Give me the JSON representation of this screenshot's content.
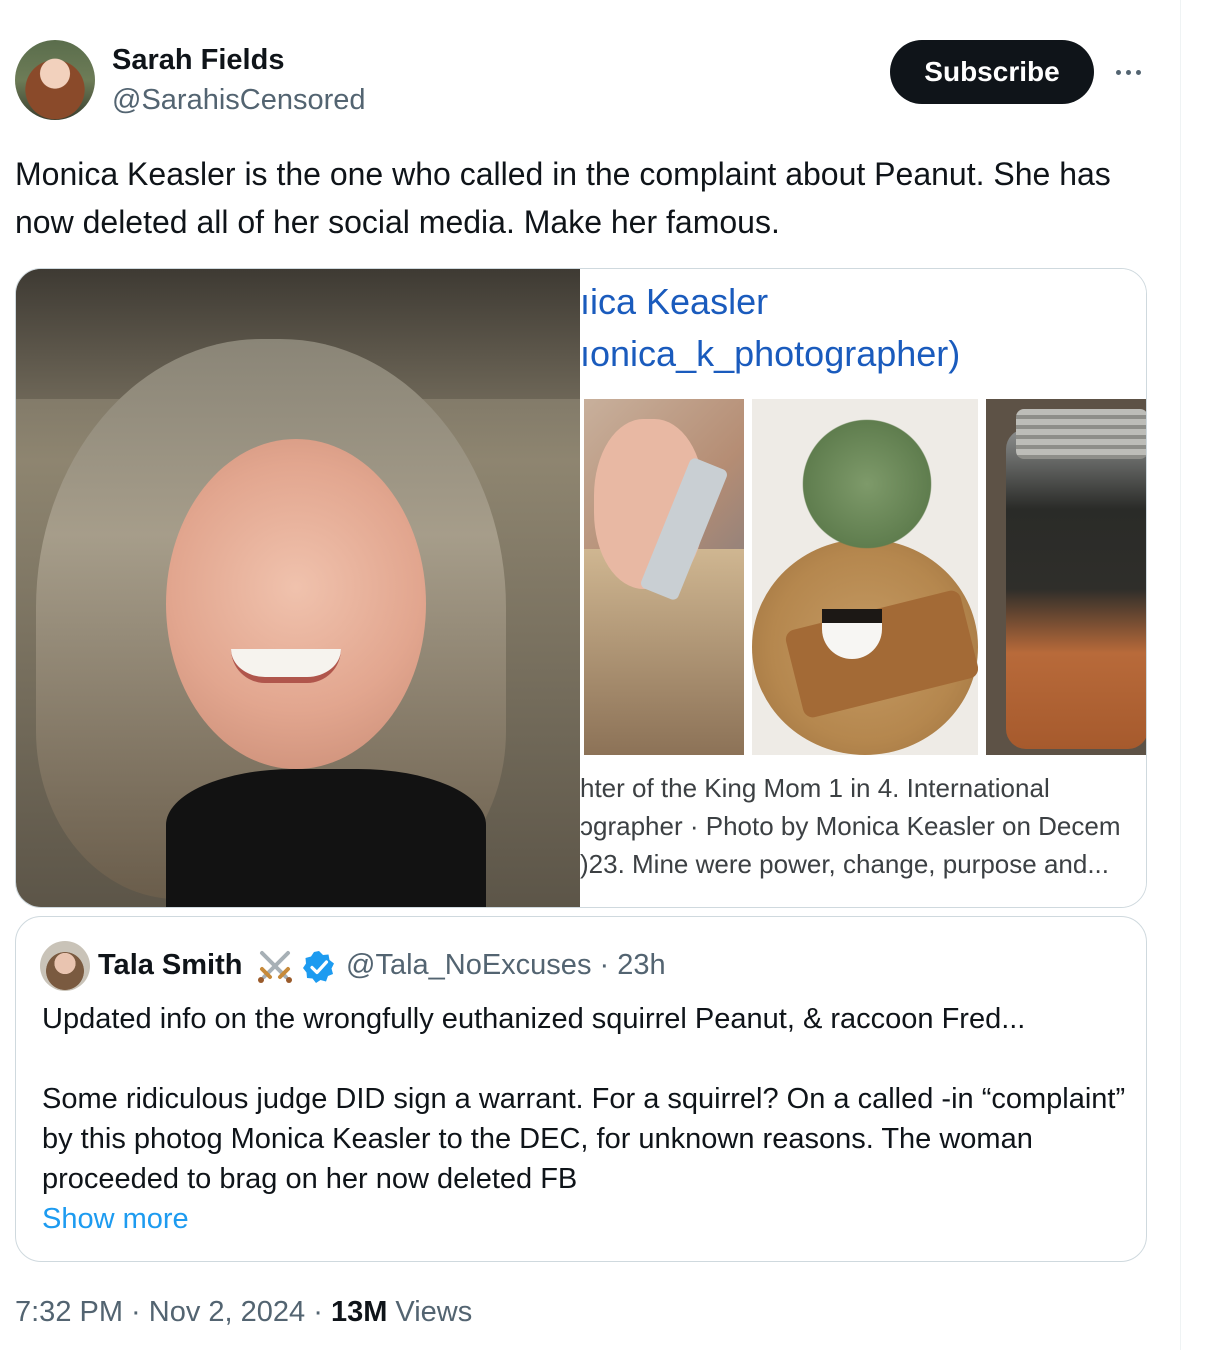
{
  "author": {
    "name": "Sarah Fields",
    "handle": "@SarahisCensored"
  },
  "actions": {
    "subscribe_label": "Subscribe",
    "more_icon": "more-horizontal-icon"
  },
  "tweet": {
    "text": "Monica Keasler is the one who called in the complaint about Peanut. She has now deleted all of her social media. Make her famous."
  },
  "media": {
    "right_title": "ıica Keasler",
    "right_handle": "ıonica_k_photographer)",
    "caption_lines": [
      "hter of the King Mom 1 in 4. International",
      "ɔgrapher · Photo by Monica Keasler on Decem",
      ")23. Mine were power, change, purpose and..."
    ]
  },
  "quote": {
    "name": "Tala Smith",
    "emoji_icon": "crossed-swords-icon",
    "verified_icon": "verified-badge-icon",
    "handle_time": "@Tala_NoExcuses · 23h",
    "line1": "Updated info on the wrongfully euthanized squirrel Peanut, & raccoon Fred...",
    "paragraph": "Some ridiculous judge DID sign a warrant. For a squirrel? On a called -in “complaint” by this photog Monica Keasler to the DEC, for unknown reasons. The woman proceeded to brag on her now deleted FB",
    "show_more": "Show more"
  },
  "meta": {
    "time_date": "7:32 PM · Nov 2, 2024 · ",
    "views_count": "13M",
    "views_label": " Views"
  },
  "colors": {
    "accent_link": "#1d9bf0",
    "secondary_text": "#536471",
    "button_bg": "#0f1419",
    "border": "#cfd9de"
  }
}
